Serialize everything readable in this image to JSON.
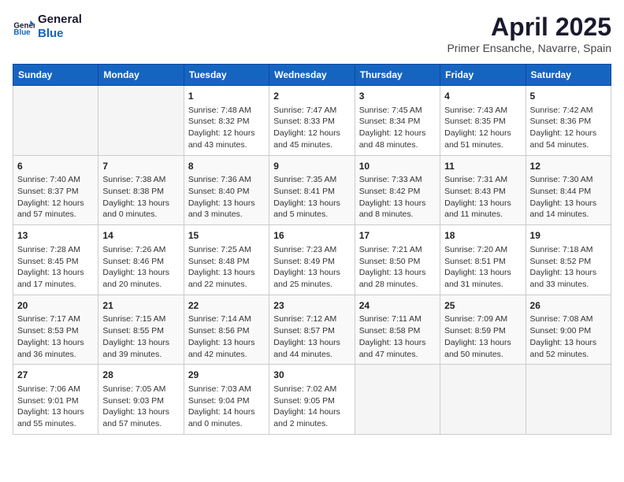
{
  "logo": {
    "line1": "General",
    "line2": "Blue"
  },
  "title": "April 2025",
  "subtitle": "Primer Ensanche, Navarre, Spain",
  "days_header": [
    "Sunday",
    "Monday",
    "Tuesday",
    "Wednesday",
    "Thursday",
    "Friday",
    "Saturday"
  ],
  "weeks": [
    [
      {
        "num": "",
        "info": ""
      },
      {
        "num": "",
        "info": ""
      },
      {
        "num": "1",
        "info": "Sunrise: 7:48 AM\nSunset: 8:32 PM\nDaylight: 12 hours and 43 minutes."
      },
      {
        "num": "2",
        "info": "Sunrise: 7:47 AM\nSunset: 8:33 PM\nDaylight: 12 hours and 45 minutes."
      },
      {
        "num": "3",
        "info": "Sunrise: 7:45 AM\nSunset: 8:34 PM\nDaylight: 12 hours and 48 minutes."
      },
      {
        "num": "4",
        "info": "Sunrise: 7:43 AM\nSunset: 8:35 PM\nDaylight: 12 hours and 51 minutes."
      },
      {
        "num": "5",
        "info": "Sunrise: 7:42 AM\nSunset: 8:36 PM\nDaylight: 12 hours and 54 minutes."
      }
    ],
    [
      {
        "num": "6",
        "info": "Sunrise: 7:40 AM\nSunset: 8:37 PM\nDaylight: 12 hours and 57 minutes."
      },
      {
        "num": "7",
        "info": "Sunrise: 7:38 AM\nSunset: 8:38 PM\nDaylight: 13 hours and 0 minutes."
      },
      {
        "num": "8",
        "info": "Sunrise: 7:36 AM\nSunset: 8:40 PM\nDaylight: 13 hours and 3 minutes."
      },
      {
        "num": "9",
        "info": "Sunrise: 7:35 AM\nSunset: 8:41 PM\nDaylight: 13 hours and 5 minutes."
      },
      {
        "num": "10",
        "info": "Sunrise: 7:33 AM\nSunset: 8:42 PM\nDaylight: 13 hours and 8 minutes."
      },
      {
        "num": "11",
        "info": "Sunrise: 7:31 AM\nSunset: 8:43 PM\nDaylight: 13 hours and 11 minutes."
      },
      {
        "num": "12",
        "info": "Sunrise: 7:30 AM\nSunset: 8:44 PM\nDaylight: 13 hours and 14 minutes."
      }
    ],
    [
      {
        "num": "13",
        "info": "Sunrise: 7:28 AM\nSunset: 8:45 PM\nDaylight: 13 hours and 17 minutes."
      },
      {
        "num": "14",
        "info": "Sunrise: 7:26 AM\nSunset: 8:46 PM\nDaylight: 13 hours and 20 minutes."
      },
      {
        "num": "15",
        "info": "Sunrise: 7:25 AM\nSunset: 8:48 PM\nDaylight: 13 hours and 22 minutes."
      },
      {
        "num": "16",
        "info": "Sunrise: 7:23 AM\nSunset: 8:49 PM\nDaylight: 13 hours and 25 minutes."
      },
      {
        "num": "17",
        "info": "Sunrise: 7:21 AM\nSunset: 8:50 PM\nDaylight: 13 hours and 28 minutes."
      },
      {
        "num": "18",
        "info": "Sunrise: 7:20 AM\nSunset: 8:51 PM\nDaylight: 13 hours and 31 minutes."
      },
      {
        "num": "19",
        "info": "Sunrise: 7:18 AM\nSunset: 8:52 PM\nDaylight: 13 hours and 33 minutes."
      }
    ],
    [
      {
        "num": "20",
        "info": "Sunrise: 7:17 AM\nSunset: 8:53 PM\nDaylight: 13 hours and 36 minutes."
      },
      {
        "num": "21",
        "info": "Sunrise: 7:15 AM\nSunset: 8:55 PM\nDaylight: 13 hours and 39 minutes."
      },
      {
        "num": "22",
        "info": "Sunrise: 7:14 AM\nSunset: 8:56 PM\nDaylight: 13 hours and 42 minutes."
      },
      {
        "num": "23",
        "info": "Sunrise: 7:12 AM\nSunset: 8:57 PM\nDaylight: 13 hours and 44 minutes."
      },
      {
        "num": "24",
        "info": "Sunrise: 7:11 AM\nSunset: 8:58 PM\nDaylight: 13 hours and 47 minutes."
      },
      {
        "num": "25",
        "info": "Sunrise: 7:09 AM\nSunset: 8:59 PM\nDaylight: 13 hours and 50 minutes."
      },
      {
        "num": "26",
        "info": "Sunrise: 7:08 AM\nSunset: 9:00 PM\nDaylight: 13 hours and 52 minutes."
      }
    ],
    [
      {
        "num": "27",
        "info": "Sunrise: 7:06 AM\nSunset: 9:01 PM\nDaylight: 13 hours and 55 minutes."
      },
      {
        "num": "28",
        "info": "Sunrise: 7:05 AM\nSunset: 9:03 PM\nDaylight: 13 hours and 57 minutes."
      },
      {
        "num": "29",
        "info": "Sunrise: 7:03 AM\nSunset: 9:04 PM\nDaylight: 14 hours and 0 minutes."
      },
      {
        "num": "30",
        "info": "Sunrise: 7:02 AM\nSunset: 9:05 PM\nDaylight: 14 hours and 2 minutes."
      },
      {
        "num": "",
        "info": ""
      },
      {
        "num": "",
        "info": ""
      },
      {
        "num": "",
        "info": ""
      }
    ]
  ]
}
